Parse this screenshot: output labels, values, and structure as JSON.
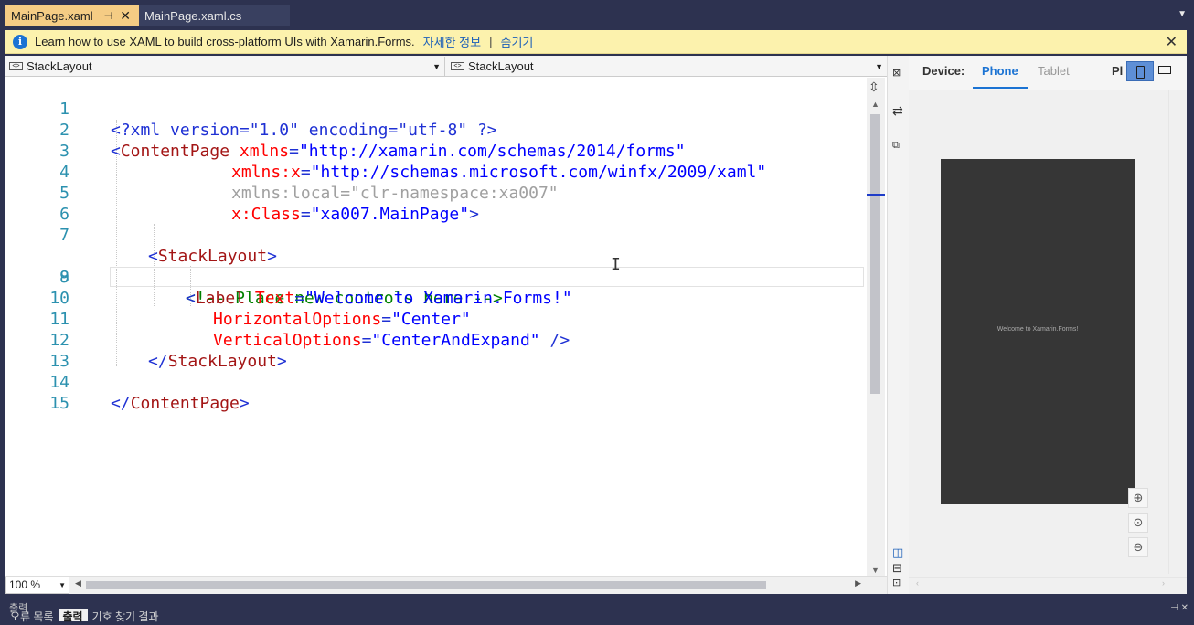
{
  "tabs": [
    {
      "label": "MainPage.xaml",
      "active": true
    },
    {
      "label": "MainPage.xaml.cs",
      "active": false
    }
  ],
  "infobar": {
    "message": "Learn how to use XAML to build cross-platform UIs with Xamarin.Forms.",
    "more_link": "자세한 정보",
    "separator": "|",
    "hide_link": "숨기기"
  },
  "nav": {
    "left": "StackLayout",
    "right": "StackLayout"
  },
  "code_lines": [
    {
      "n": "1"
    },
    {
      "n": "2"
    },
    {
      "n": "3"
    },
    {
      "n": "4"
    },
    {
      "n": "5"
    },
    {
      "n": "6"
    },
    {
      "n": "7"
    },
    {
      "n": "8"
    },
    {
      "n": "9"
    },
    {
      "n": "10"
    },
    {
      "n": "11"
    },
    {
      "n": "12"
    },
    {
      "n": "13"
    },
    {
      "n": "14"
    },
    {
      "n": "15"
    }
  ],
  "code": {
    "l1": "<?xml version=\"1.0\" encoding=\"utf-8\" ?>",
    "l2_tag": "ContentPage",
    "l2_attr": "xmlns",
    "l2_val": "\"http://xamarin.com/schemas/2014/forms\"",
    "l3_attr": "xmlns:x",
    "l3_val": "\"http://schemas.microsoft.com/winfx/2009/xaml\"",
    "l4_attr": "xmlns:local",
    "l4_val": "\"clr-namespace:xa007\"",
    "l5_attr": "x:Class",
    "l5_val": "\"xa007.MainPage\"",
    "l7_tag": "StackLayout",
    "l8_comment": "<!-- Place new controls here -->",
    "l9_tag": "Label",
    "l9_attr": "Text",
    "l9_val": "\"Welcome to Xamarin.Forms!\"",
    "l10_attr": "HorizontalOptions",
    "l10_val": "\"Center\"",
    "l11_attr": "VerticalOptions",
    "l11_val": "\"CenterAndExpand\"",
    "l12_tag": "StackLayout",
    "l14_tag": "ContentPage"
  },
  "zoom": "100 %",
  "designer": {
    "device_label": "Device:",
    "phone_tab": "Phone",
    "tablet_tab": "Tablet",
    "platform_label": "Pl",
    "preview_text": "Welcome to Xamarin.Forms!"
  },
  "bottom_panel": {
    "title": "출력",
    "tabs": [
      "오류 목록",
      "출력",
      "기호 찾기 결과"
    ],
    "active_tab": "출력"
  }
}
